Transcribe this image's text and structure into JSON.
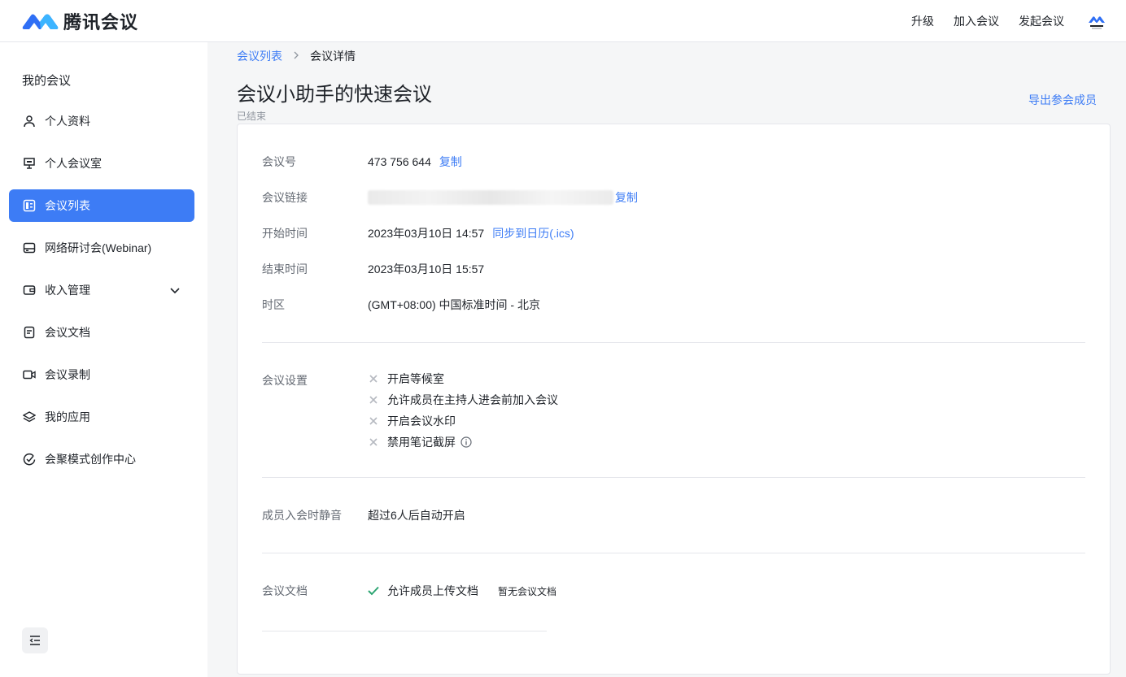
{
  "brand": {
    "name": "腾讯会议",
    "accent": "#3d7cf5"
  },
  "topnav": {
    "upgrade": "升级",
    "join": "加入会议",
    "start": "发起会议"
  },
  "sidebar": {
    "title": "我的会议",
    "items": [
      {
        "label": "个人资料",
        "icon": "user-icon"
      },
      {
        "label": "个人会议室",
        "icon": "monitor-icon"
      },
      {
        "label": "会议列表",
        "icon": "list-icon",
        "active": true
      },
      {
        "label": "网络研讨会(Webinar)",
        "icon": "webinar-icon"
      },
      {
        "label": "收入管理",
        "icon": "wallet-icon",
        "expandable": true
      },
      {
        "label": "会议文档",
        "icon": "document-icon"
      },
      {
        "label": "会议录制",
        "icon": "video-icon"
      },
      {
        "label": "我的应用",
        "icon": "layers-icon"
      },
      {
        "label": "会聚模式创作中心",
        "icon": "creative-icon"
      }
    ]
  },
  "breadcrumb": {
    "parent": "会议列表",
    "current": "会议详情"
  },
  "meeting": {
    "title": "会议小助手的快速会议",
    "status": "已结束",
    "export_label": "导出参会成员",
    "details": {
      "id_label": "会议号",
      "id_value": "473 756 644",
      "copy": "复制",
      "link_label": "会议链接",
      "link_copy": "复制",
      "start_label": "开始时间",
      "start_value": "2023年03月10日 14:57",
      "sync": "同步到日历(.ics)",
      "end_label": "结束时间",
      "end_value": "2023年03月10日 15:57",
      "tz_label": "时区",
      "tz_value": "(GMT+08:00) 中国标准时间 - 北京"
    },
    "settings": {
      "label": "会议设置",
      "options": [
        "开启等候室",
        "允许成员在主持人进会前加入会议",
        "开启会议水印",
        "禁用笔记截屏"
      ]
    },
    "mute": {
      "label": "成员入会时静音",
      "value": "超过6人后自动开启"
    },
    "docs": {
      "label": "会议文档",
      "upload": "允许成员上传文档",
      "empty": "暂无会议文档"
    }
  }
}
